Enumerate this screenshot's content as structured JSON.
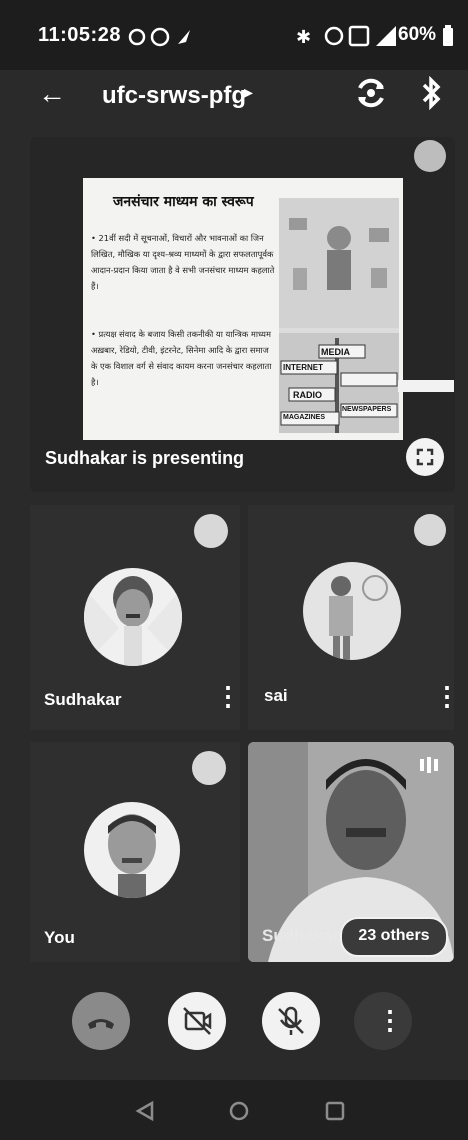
{
  "status_bar": {
    "time": "11:05:28",
    "battery": "60%"
  },
  "app_bar": {
    "title": "ufc-srws-pfg",
    "title_chevron": "▸"
  },
  "presentation": {
    "label": "Sudhakar is presenting",
    "slide": {
      "title": "जनसंचार माध्यम का स्वरूप",
      "bullet_1": "• 21वीं सदी में सूचनाओं, विचारों और भावनाओं का जिन लिखित, मौखिक या दृश्य-श्रव्य माध्यमों के द्वारा सफलतापूर्वक आदान-प्रदान किया जाता है वे सभी जनसंचार माध्यम कहलाते हैं।",
      "bullet_2": "• प्रत्यक्ष संवाद के बजाय किसी तकनीकी या यान्त्रिक माध्यम अख़बार, रेडियो, टीवी, इंटरनेट, सिनेमा आदि के द्वारा समाज के एक विशाल वर्ग से संवाद कायम करना जनसंचार कहलाता है।",
      "sign_labels": [
        "MEDIA",
        "INTERNET",
        "RADIO",
        "MAGAZINES",
        "NEWSPAPERS"
      ]
    }
  },
  "participants": [
    {
      "name": "Sudhakar"
    },
    {
      "name": "sai"
    },
    {
      "name": "You"
    },
    {
      "name": "Sudhakar"
    }
  ],
  "others_badge": "23 others",
  "icons": {
    "back": "←",
    "more": "⋮"
  },
  "colors": {
    "end_call": "#8a8a8a",
    "control_light": "#f2f2f2",
    "background": "#2a2a2a"
  }
}
